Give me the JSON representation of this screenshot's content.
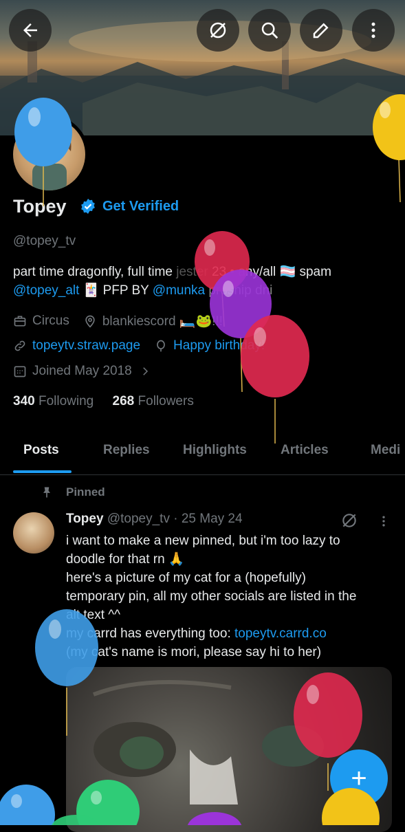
{
  "header": {
    "back_icon": "arrow-left-icon",
    "actions": [
      "grok-icon",
      "search-icon",
      "edit-icon",
      "more-icon"
    ]
  },
  "profile": {
    "name": "Topey",
    "get_verified": "Get Verified",
    "handle": "@topey_tv",
    "bio_line1_a": "part time dragonfly, full time ",
    "bio_line1_b": "jester",
    "bio_line1_c": " 23 • any/all 🏳️‍⚧️ spam",
    "bio_line2_link1": "@topey_alt",
    "bio_line2_a": " 🃏 PFP BY ",
    "bio_line2_link2": "@munka",
    "bio_line2_b": " proship dni",
    "category": "Circus",
    "location": "blankiescord 🛏️🐸!!!",
    "website": "topeytv.straw.page",
    "birthday": "Happy birthday!",
    "joined": "Joined May 2018",
    "following_count": "340",
    "following_label": "Following",
    "followers_count": "268",
    "followers_label": "Followers"
  },
  "tabs": [
    "Posts",
    "Replies",
    "Highlights",
    "Articles",
    "Medi"
  ],
  "post": {
    "pinned_label": "Pinned",
    "author": "Topey",
    "handle_date": "@topey_tv · 25 May 24",
    "line1": "i want to make a new pinned, but i'm too lazy to",
    "line2": "doodle for that rn 🙏",
    "line3": "here's a picture of my cat for a (hopefully)",
    "line4": "temporary pin, all my other socials are listed in the",
    "line5": "alt text ^^",
    "line6_a": "my carrd has everything too: ",
    "line6_link": "topeytv.carrd.co",
    "line7": "(my cat's name is mori, please say hi to her)"
  },
  "fab_label": "+",
  "colors": {
    "accent": "#1d9bf0",
    "text": "#e7e9ea",
    "muted": "#71767b",
    "balloon_red": "#e0294f",
    "balloon_purple": "#9b34d9",
    "balloon_blue": "#3f9de8",
    "balloon_yellow": "#f2c318",
    "balloon_green": "#2fcc77"
  }
}
